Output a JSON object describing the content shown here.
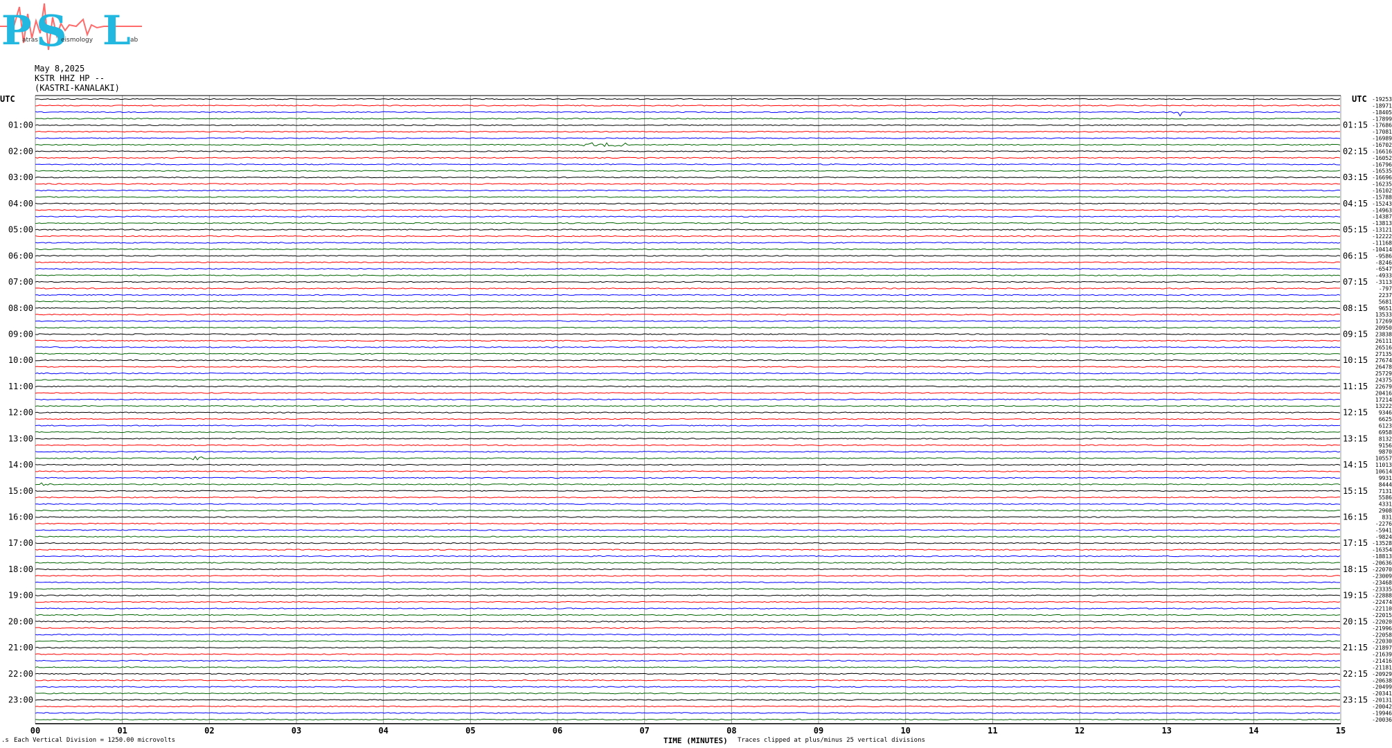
{
  "logo": {
    "letters": [
      "P",
      "S",
      "L"
    ],
    "subtitle_fragments": [
      "atras",
      "eismology",
      "ab"
    ]
  },
  "header": {
    "date": "May 8,2025",
    "station": "KSTR HHZ HP --",
    "location": "(KASTRI-KANALAKI)"
  },
  "chart_data": {
    "type": "line",
    "title": "KSTR HHZ HP --",
    "xlabel": "TIME (MINUTES)",
    "x_ticks": [
      "00",
      "01",
      "02",
      "03",
      "04",
      "05",
      "06",
      "07",
      "08",
      "09",
      "10",
      "11",
      "12",
      "13",
      "14",
      "15"
    ],
    "xlim": [
      0,
      15
    ],
    "rows": 96,
    "minutes_per_row": 15,
    "colors": [
      "#000000",
      "#ff0000",
      "#0000ff",
      "#006400"
    ],
    "left_label_header": "UTC",
    "right_label_header": "UTC",
    "hour_labels_left": [
      "01:00",
      "02:00",
      "03:00",
      "04:00",
      "05:00",
      "06:00",
      "07:00",
      "08:00",
      "09:00",
      "10:00",
      "11:00",
      "12:00",
      "13:00",
      "14:00",
      "15:00",
      "16:00",
      "17:00",
      "18:00",
      "19:00",
      "20:00",
      "21:00",
      "22:00",
      "23:00"
    ],
    "hour_labels_right": [
      "01:15",
      "02:15",
      "03:15",
      "04:15",
      "05:15",
      "06:15",
      "07:15",
      "08:15",
      "09:15",
      "10:15",
      "11:15",
      "12:15",
      "13:15",
      "14:15",
      "15:15",
      "16:15",
      "17:15",
      "18:15",
      "19:15",
      "20:15",
      "21:15",
      "22:15",
      "23:15"
    ],
    "row_offsets": [
      "-19253",
      "-18971",
      "-18405",
      "-17899",
      "-17686",
      "-17081",
      "-16989",
      "-16702",
      "-16616",
      "-16052",
      "-16796",
      "-16535",
      "-16696",
      "-16235",
      "-16102",
      "-15788",
      "-15243",
      "-14963",
      "-14387",
      "-13813",
      "-13121",
      "-12222",
      "-11168",
      "-10414",
      "-9586",
      "-8246",
      "-6547",
      "-4933",
      "-3113",
      "-797",
      "2237",
      "5681",
      "9651",
      "13533",
      "17269",
      "20950",
      "23838",
      "26111",
      "26516",
      "27135",
      "27674",
      "26478",
      "25729",
      "24375",
      "22679",
      "20416",
      "17214",
      "13222",
      "9346",
      "6625",
      "6123",
      "6958",
      "8132",
      "9156",
      "9870",
      "10557",
      "11013",
      "10614",
      "9931",
      "8444",
      "7131",
      "5586",
      "4331",
      "2908",
      "831",
      "-2276",
      "-5941",
      "-9824",
      "-13528",
      "-16354",
      "-18813",
      "-20636",
      "-22070",
      "-23009",
      "-23468",
      "-23335",
      "-22888",
      "-22474",
      "-22110",
      "-22015",
      "-22020",
      "-21996",
      "-22058",
      "-22030",
      "-21897",
      "-21639",
      "-21416",
      "-21181",
      "-20929",
      "-20638",
      "-20499",
      "-20341",
      "-20131",
      "-20042",
      "-19946",
      "-20036"
    ],
    "events": [
      {
        "row": 2,
        "minute": 13.05,
        "amplitude": 6
      },
      {
        "row": 7,
        "minute": 6.3,
        "amplitude": 3,
        "duration": 0.5
      },
      {
        "row": 55,
        "minute": 1.8,
        "amplitude": 3
      },
      {
        "row": 59,
        "minute": 0.05,
        "amplitude": 3
      }
    ],
    "annotations": {
      "left": "Each Vertical Division = 1250.00 microvolts",
      "right": "Traces clipped at plus/minus 25 vertical divisions"
    }
  }
}
